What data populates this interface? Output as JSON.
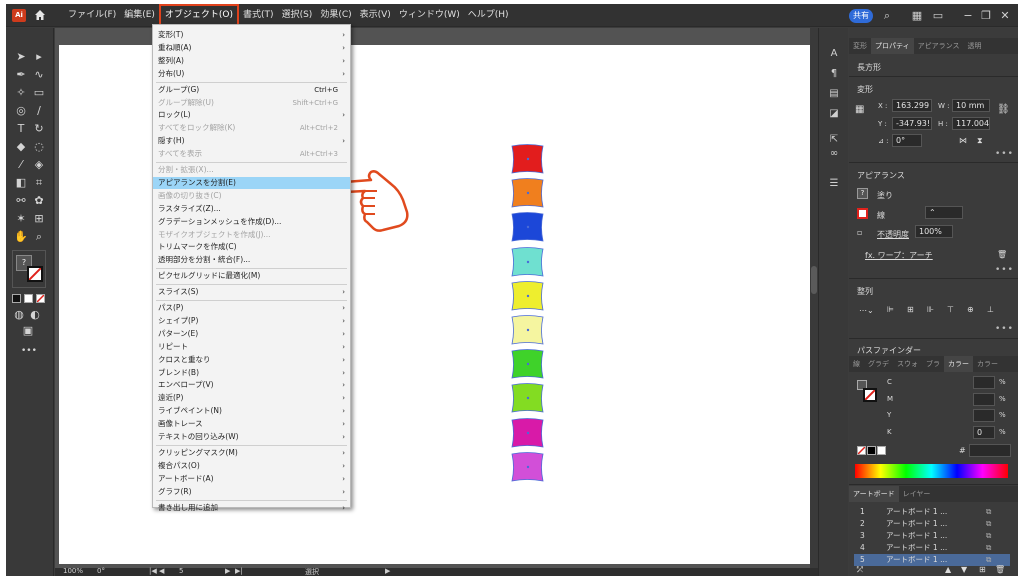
{
  "menubar": {
    "logo": "Ai",
    "items": [
      "ファイル(F)",
      "編集(E)",
      "オブジェクト(O)",
      "書式(T)",
      "選択(S)",
      "効果(C)",
      "表示(V)",
      "ウィンドウ(W)",
      "ヘルプ(H)"
    ],
    "share": "共有"
  },
  "menu": {
    "items": [
      {
        "label": "変形(T)",
        "shortcut": "",
        "arrow": "›",
        "disabled": false
      },
      {
        "label": "重ね順(A)",
        "shortcut": "",
        "arrow": "›",
        "disabled": false
      },
      {
        "label": "整列(A)",
        "shortcut": "",
        "arrow": "›",
        "disabled": false
      },
      {
        "label": "分布(U)",
        "shortcut": "",
        "arrow": "›",
        "disabled": false
      },
      {
        "label": "グループ(G)",
        "shortcut": "Ctrl+G",
        "arrow": "",
        "disabled": false
      },
      {
        "label": "グループ解除(U)",
        "shortcut": "Shift+Ctrl+G",
        "arrow": "",
        "disabled": true
      },
      {
        "label": "ロック(L)",
        "shortcut": "",
        "arrow": "›",
        "disabled": false
      },
      {
        "label": "すべてをロック解除(K)",
        "shortcut": "Alt+Ctrl+2",
        "arrow": "",
        "disabled": true
      },
      {
        "label": "隠す(H)",
        "shortcut": "",
        "arrow": "›",
        "disabled": false
      },
      {
        "label": "すべてを表示",
        "shortcut": "Alt+Ctrl+3",
        "arrow": "",
        "disabled": true
      },
      {
        "label": "分割・拡張(X)...",
        "shortcut": "",
        "arrow": "",
        "disabled": true
      },
      {
        "label": "アピアランスを分割(E)",
        "shortcut": "",
        "arrow": "",
        "disabled": false,
        "highlight": true
      },
      {
        "label": "画像の切り抜き(C)",
        "shortcut": "",
        "arrow": "",
        "disabled": true
      },
      {
        "label": "ラスタライズ(Z)...",
        "shortcut": "",
        "arrow": "",
        "disabled": false
      },
      {
        "label": "グラデーションメッシュを作成(D)...",
        "shortcut": "",
        "arrow": "",
        "disabled": false
      },
      {
        "label": "モザイクオブジェクトを作成(J)...",
        "shortcut": "",
        "arrow": "",
        "disabled": true
      },
      {
        "label": "トリムマークを作成(C)",
        "shortcut": "",
        "arrow": "",
        "disabled": false
      },
      {
        "label": "透明部分を分割・統合(F)...",
        "shortcut": "",
        "arrow": "",
        "disabled": false
      },
      {
        "label": "ピクセルグリッドに最適化(M)",
        "shortcut": "",
        "arrow": "",
        "disabled": false
      },
      {
        "label": "スライス(S)",
        "shortcut": "",
        "arrow": "›",
        "disabled": false
      },
      {
        "label": "パス(P)",
        "shortcut": "",
        "arrow": "›",
        "disabled": false
      },
      {
        "label": "シェイプ(P)",
        "shortcut": "",
        "arrow": "›",
        "disabled": false
      },
      {
        "label": "パターン(E)",
        "shortcut": "",
        "arrow": "›",
        "disabled": false
      },
      {
        "label": "リピート",
        "shortcut": "",
        "arrow": "›",
        "disabled": false
      },
      {
        "label": "クロスと重なり",
        "shortcut": "",
        "arrow": "›",
        "disabled": false
      },
      {
        "label": "ブレンド(B)",
        "shortcut": "",
        "arrow": "›",
        "disabled": false
      },
      {
        "label": "エンベロープ(V)",
        "shortcut": "",
        "arrow": "›",
        "disabled": false
      },
      {
        "label": "遠近(P)",
        "shortcut": "",
        "arrow": "›",
        "disabled": false
      },
      {
        "label": "ライブペイント(N)",
        "shortcut": "",
        "arrow": "›",
        "disabled": false
      },
      {
        "label": "画像トレース",
        "shortcut": "",
        "arrow": "›",
        "disabled": false
      },
      {
        "label": "テキストの回り込み(W)",
        "shortcut": "",
        "arrow": "›",
        "disabled": false
      },
      {
        "label": "クリッピングマスク(M)",
        "shortcut": "",
        "arrow": "›",
        "disabled": false
      },
      {
        "label": "複合パス(O)",
        "shortcut": "",
        "arrow": "›",
        "disabled": false
      },
      {
        "label": "アートボード(A)",
        "shortcut": "",
        "arrow": "›",
        "disabled": false
      },
      {
        "label": "グラフ(R)",
        "shortcut": "",
        "arrow": "›",
        "disabled": false
      },
      {
        "label": "書き出し用に追加",
        "shortcut": "",
        "arrow": "›",
        "disabled": false
      }
    ]
  },
  "swatches": [
    "#e21d1d",
    "#f07f1e",
    "#1c47d8",
    "#6fe0d0",
    "#eeee2e",
    "#f5f5a0",
    "#3fd22a",
    "#83dc22",
    "#d81aa8",
    "#d24fd8"
  ],
  "panel": {
    "tabs": [
      "変形",
      "プロパティ",
      "アピアランス",
      "透明"
    ],
    "object_type": "長方形",
    "transform_title": "変形",
    "x_label": "X :",
    "x_value": "163.299",
    "y_label": "Y :",
    "y_value": "-347.93!",
    "w_label": "W :",
    "w_value": "10 mm",
    "h_label": "H :",
    "h_value": "117.004",
    "angle_label": "⊿ :",
    "angle_value": "0°",
    "appearance_title": "アピアランス",
    "fill_label": "塗り",
    "stroke_label": "線",
    "opacity_label": "不透明度",
    "opacity_value": "100%",
    "effect_label": "fx. ワープ：アーチ",
    "align_title": "整列",
    "pathfinder_title": "パスファインダー",
    "color_tabs": [
      "線",
      "グラデ",
      "スウォ",
      "ブラ",
      "カラー",
      "カラー"
    ],
    "cmyk": [
      "C",
      "M",
      "Y",
      "K"
    ],
    "k_value": "0",
    "percent": "%",
    "hash": "#",
    "artboard_tabs": [
      "アートボード",
      "レイヤー"
    ],
    "artboards": [
      {
        "num": "1",
        "name": "アートボード 1 ..."
      },
      {
        "num": "2",
        "name": "アートボード 1 ..."
      },
      {
        "num": "3",
        "name": "アートボード 1 ..."
      },
      {
        "num": "4",
        "name": "アートボード 1 ..."
      },
      {
        "num": "5",
        "name": "アートボード 1 ..."
      }
    ]
  },
  "status": {
    "zoom": "100%",
    "rotation": "0°",
    "artboard_num": "5",
    "tool": "選択"
  }
}
